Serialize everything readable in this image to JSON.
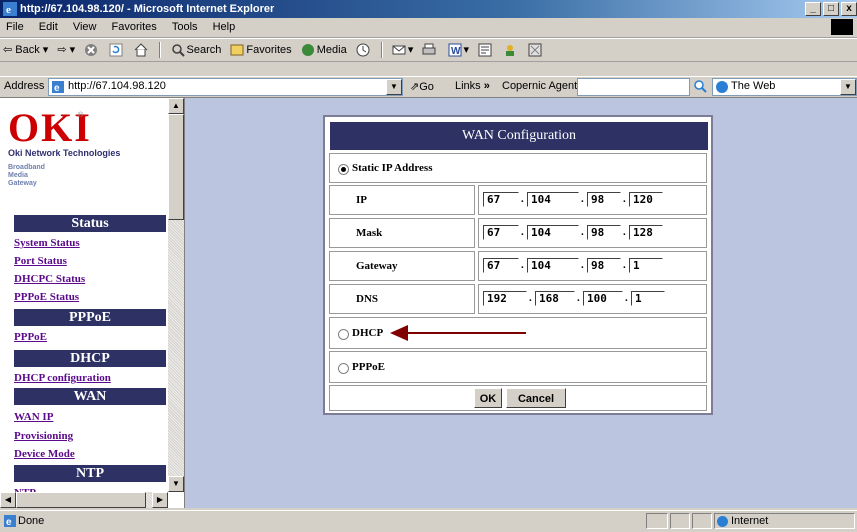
{
  "window": {
    "title": "http://67.104.98.120/ - Microsoft Internet Explorer",
    "minimize": "_",
    "restore": "□",
    "close": "x"
  },
  "menu": [
    "File",
    "Edit",
    "View",
    "Favorites",
    "Tools",
    "Help"
  ],
  "toolbar": {
    "back": "Back",
    "search": "Search",
    "favorites": "Favorites",
    "media": "Media"
  },
  "address": {
    "label": "Address",
    "url": "http://67.104.98.120",
    "go": "Go",
    "links": "Links",
    "links_chevron": "»",
    "copernic": "Copernic Agent",
    "copernic_value": "",
    "web_search": "The Web"
  },
  "sidebar": {
    "logo": {
      "name": "OKI",
      "registered": "®",
      "company": "Oki Network Technologies",
      "product_lines": [
        "Broadband",
        "Media",
        "Gateway"
      ]
    },
    "sections": [
      {
        "header": "Status",
        "links": [
          "System Status",
          "Port Status",
          "DHCPC Status",
          "PPPoE Status"
        ]
      },
      {
        "header": "PPPoE",
        "links": [
          "PPPoE"
        ]
      },
      {
        "header": "DHCP",
        "links": [
          "DHCP configuration"
        ]
      },
      {
        "header": "WAN",
        "links": [
          "WAN IP",
          "Provisioning",
          "Device Mode"
        ]
      },
      {
        "header": "NTP",
        "links": [
          "NTP"
        ]
      }
    ]
  },
  "wan": {
    "title": "WAN Configuration",
    "static_label": "Static IP Address",
    "static_selected": true,
    "fields": [
      {
        "label": "IP",
        "octets": [
          "67",
          "104",
          "98",
          "120"
        ]
      },
      {
        "label": "Mask",
        "octets": [
          "67",
          "104",
          "98",
          "128"
        ]
      },
      {
        "label": "Gateway",
        "octets": [
          "67",
          "104",
          "98",
          "1"
        ]
      },
      {
        "label": "DNS",
        "octets": [
          "192",
          "168",
          "100",
          "1"
        ]
      }
    ],
    "dhcp_label": "DHCP",
    "pppoe_label": "PPPoE",
    "ok": "OK",
    "cancel": "Cancel",
    "arrow_color": "#800000"
  },
  "status": {
    "text": "Done",
    "zone": "Internet"
  }
}
